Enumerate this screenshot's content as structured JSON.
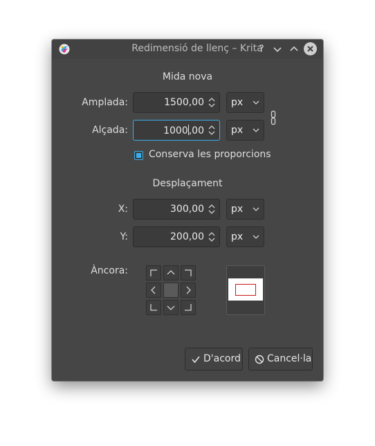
{
  "window": {
    "title": "Redimensió de llenç – Krita",
    "help_glyph": "?",
    "minimize_glyph": "⌄",
    "maximize_glyph": "⌃"
  },
  "size_section": {
    "heading": "Mida nova",
    "width_label": "Amplada:",
    "width_value": "1500,00",
    "width_unit": "px",
    "height_label": "Alçada:",
    "height_value_before_cursor": "1000",
    "height_value_after_cursor": ",00",
    "height_unit": "px",
    "keep_ratio_label": "Conserva les proporcions",
    "keep_ratio_checked": true
  },
  "offset_section": {
    "heading": "Desplaçament",
    "x_label": "X:",
    "x_value": "300,00",
    "x_unit": "px",
    "y_label": "Y:",
    "y_value": "200,00",
    "y_unit": "px"
  },
  "anchor": {
    "label": "Àncora:",
    "selected": "center"
  },
  "buttons": {
    "ok_label": "D'acord",
    "cancel_label": "Cancel·la"
  },
  "colors": {
    "dialog_bg": "#464646",
    "accent": "#3daee9",
    "preview_image_border": "#c81a1a"
  }
}
